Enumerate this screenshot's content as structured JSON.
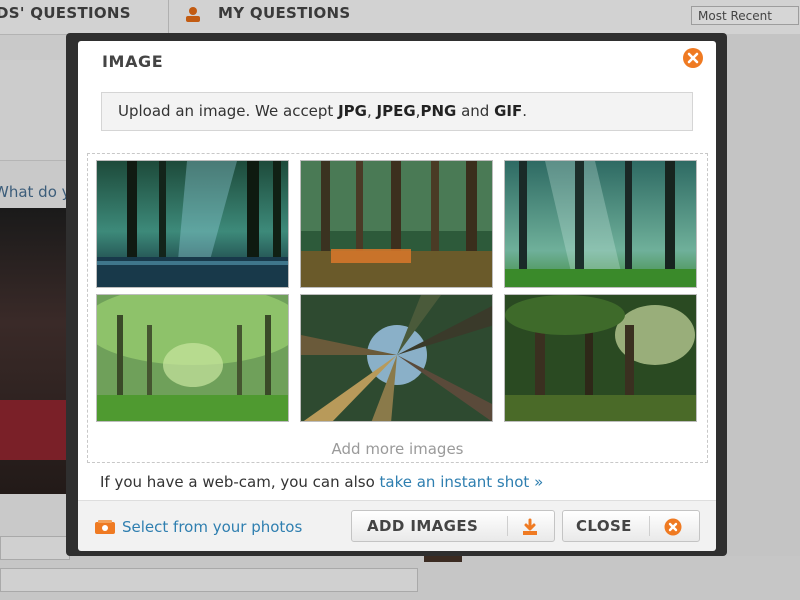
{
  "background": {
    "tabs": [
      {
        "label": "DS' QUESTIONS"
      },
      {
        "label": "MY QUESTIONS"
      }
    ],
    "sort_select": "Most Recent",
    "prompt_text": "What do y"
  },
  "modal": {
    "title": "IMAGE",
    "info": {
      "prefix": "Upload an image. We accept ",
      "fmt_jpg": "JPG",
      "sep1": ", ",
      "fmt_jpeg": "JPEG",
      "sep2": ",",
      "fmt_png": "PNG",
      "and": " and ",
      "fmt_gif": "GIF",
      "suffix": "."
    },
    "gallery_add_more": "Add more images",
    "webcam_text": "If you have a web-cam, you can also ",
    "webcam_link": "take an instant shot »",
    "footer": {
      "select_photos": "Select from your photos",
      "add_images": "ADD IMAGES",
      "close": "CLOSE"
    }
  },
  "colors": {
    "accent_orange": "#ef7a22",
    "link_blue": "#2f7fb0"
  }
}
